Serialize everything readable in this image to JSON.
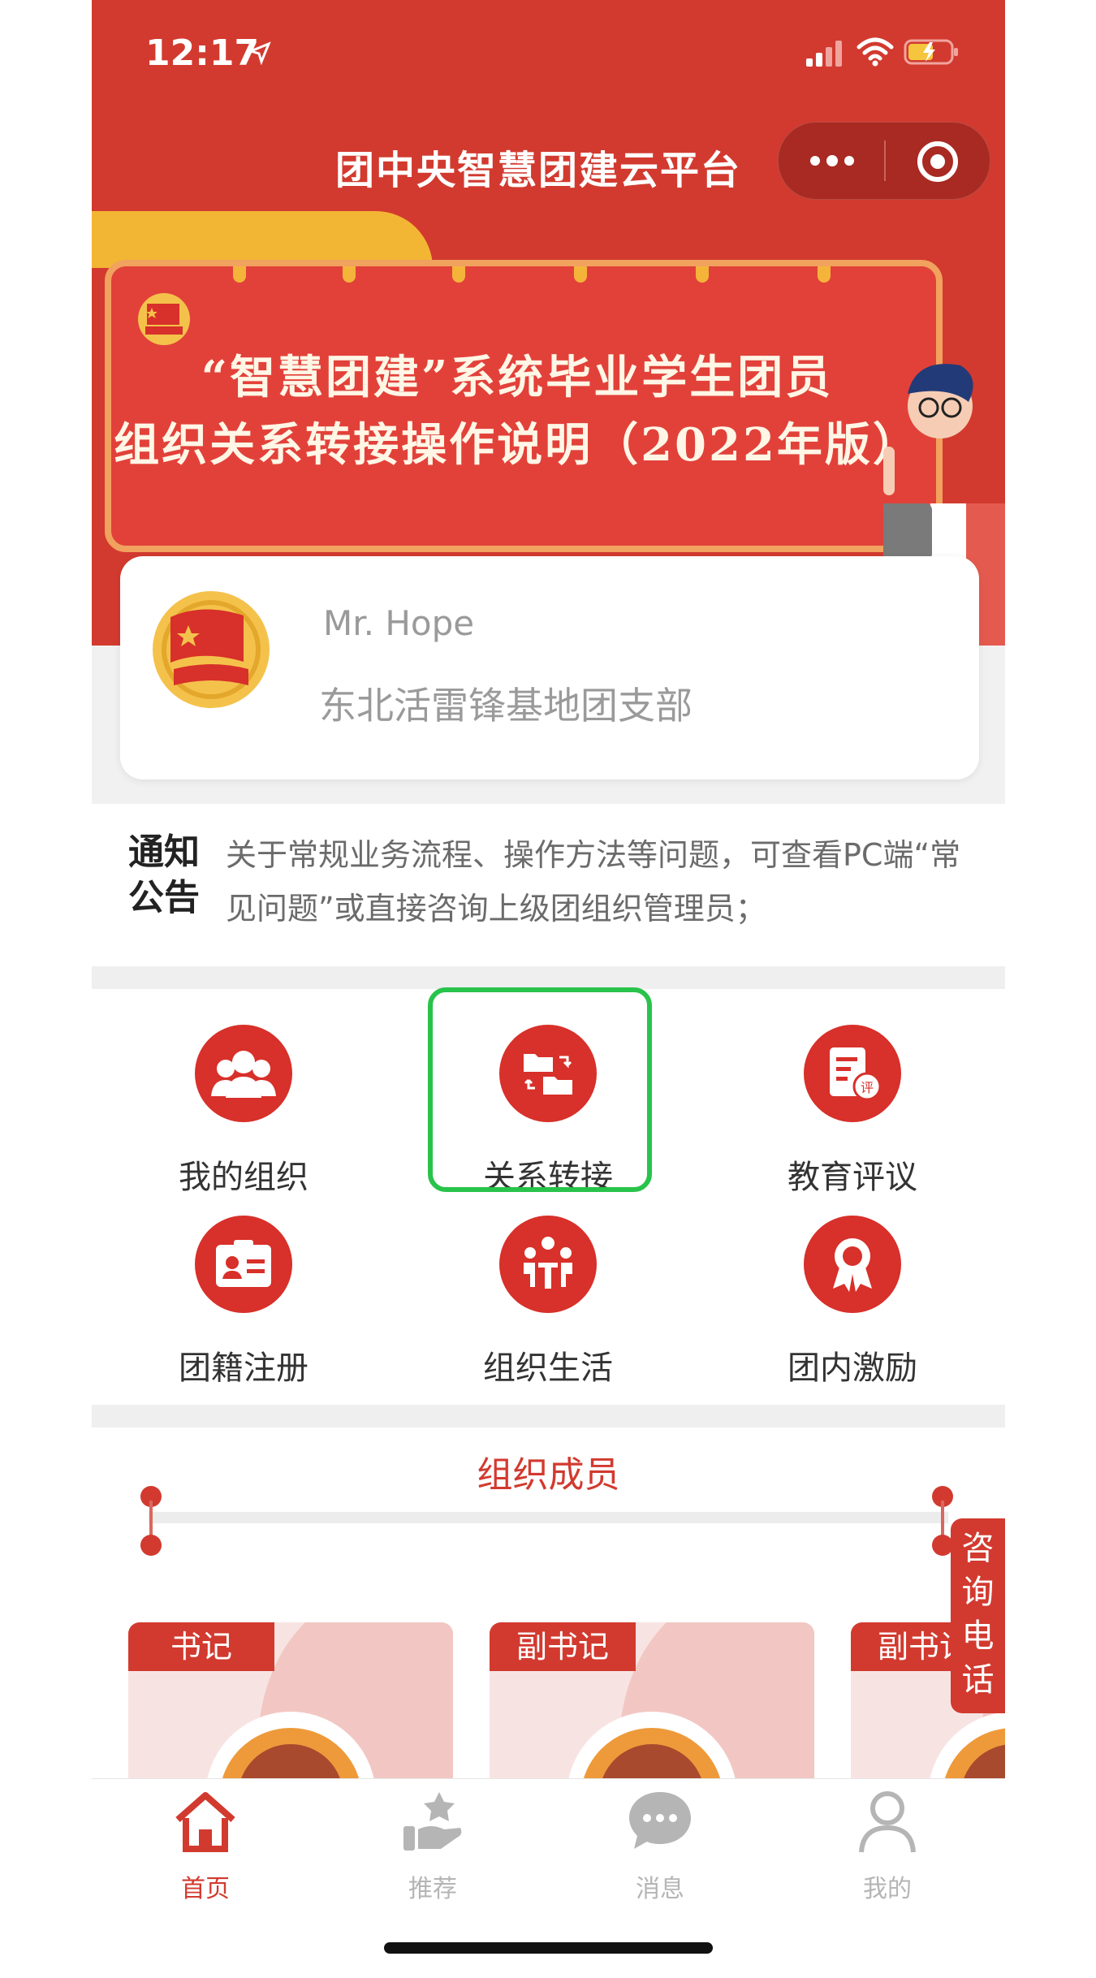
{
  "status_bar": {
    "time": "12:17"
  },
  "nav": {
    "title": "团中央智慧团建云平台"
  },
  "banner": {
    "line1": "“智慧团建”系统毕业学生团员",
    "line2": "组织关系转接操作说明（2022年版）"
  },
  "profile": {
    "name": "Mr. Hope",
    "organization": "东北活雷锋基地团支部"
  },
  "notice": {
    "tag_line1": "通知",
    "tag_line2": "公告",
    "text": "关于常规业务流程、操作方法等问题，可查看PC端“常见问题”或直接咨询上级团组织管理员；"
  },
  "grid": {
    "items": [
      {
        "label": "我的组织",
        "icon": "people-icon"
      },
      {
        "label": "关系转接",
        "icon": "folder-transfer-icon"
      },
      {
        "label": "教育评议",
        "icon": "review-document-icon"
      },
      {
        "label": "团籍注册",
        "icon": "id-card-icon"
      },
      {
        "label": "组织生活",
        "icon": "meeting-icon"
      },
      {
        "label": "团内激励",
        "icon": "award-ribbon-icon"
      }
    ]
  },
  "members": {
    "title": "组织成员",
    "cards": [
      {
        "role": "书记"
      },
      {
        "role": "副书记"
      },
      {
        "role": "副书记"
      }
    ]
  },
  "consult": {
    "chars": [
      "咨",
      "询",
      "电",
      "话"
    ]
  },
  "tabbar": {
    "tabs": [
      {
        "label": "首页",
        "icon": "home-icon",
        "active": true
      },
      {
        "label": "推荐",
        "icon": "recommend-icon",
        "active": false
      },
      {
        "label": "消息",
        "icon": "chat-bubble-icon",
        "active": false
      },
      {
        "label": "我的",
        "icon": "person-icon",
        "active": false
      }
    ]
  },
  "colors": {
    "brand_red": "#d23a2f",
    "gold": "#f2b634",
    "highlight_green": "#28c34b",
    "tab_inactive": "#b5b5b5"
  }
}
